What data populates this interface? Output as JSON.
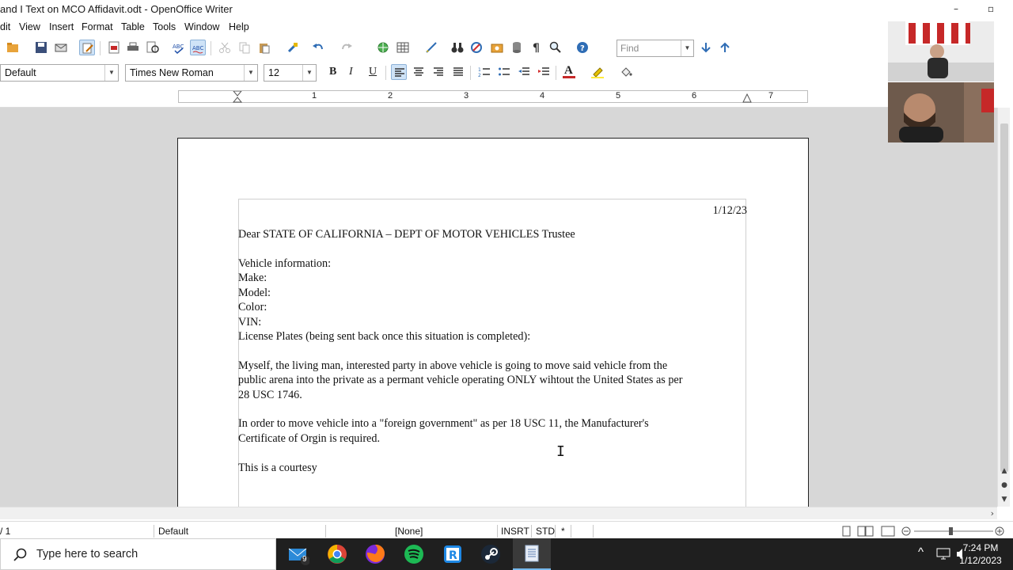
{
  "window": {
    "title": "and I Text on MCO Affidavit.odt - OpenOffice Writer",
    "minimize_glyph": "–",
    "restore_glyph": "▫"
  },
  "menu": [
    {
      "label": "dit"
    },
    {
      "label": "View"
    },
    {
      "label": "Insert"
    },
    {
      "label": "Format"
    },
    {
      "label": "Table"
    },
    {
      "label": "Tools"
    },
    {
      "label": "Window"
    },
    {
      "label": "Help"
    }
  ],
  "toolbar": {
    "find_placeholder": "Find",
    "paragraph_style": "Default",
    "font_name": "Times New Roman",
    "font_size": "12",
    "bold_label": "B",
    "italic_label": "I",
    "underline_label": "U",
    "font_color_label": "A"
  },
  "ruler": {
    "numbers": [
      "1",
      "2",
      "3",
      "4",
      "5",
      "6",
      "7"
    ]
  },
  "document": {
    "date": "1/12/23",
    "lines": [
      "Dear STATE OF CALIFORNIA – DEPT OF MOTOR VEHICLES Trustee",
      "Vehicle information:",
      "Make:",
      "Model:",
      "Color:",
      "VIN:",
      "License Plates (being sent back once this situation is completed):",
      "Myself, the living man, interested party in above vehicle is going to move said vehicle from the",
      "public arena into the private as a permant vehicle operating ONLY wihtout the United States as per",
      "28 USC 1746.",
      "In order to move vehicle into a \"foreign government\" as per 18 USC 11, the Manufacturer's",
      "Certificate of Orgin is required.",
      "This is a courtesy"
    ]
  },
  "status": {
    "page": "/ 1",
    "page_style": "Default",
    "language": "[None]",
    "insert_mode": "INSRT",
    "selection_mode": "STD",
    "modified": "*"
  },
  "taskbar": {
    "search_placeholder": "Type here to search",
    "mail_badge": "9",
    "time": "7:24 PM",
    "date": "1/12/2023"
  },
  "colors": {
    "accent": "#76b9ed",
    "active_button": "#cfe3f7",
    "doc_background": "#d7d7d7",
    "taskbar": "#1f1f1f"
  }
}
